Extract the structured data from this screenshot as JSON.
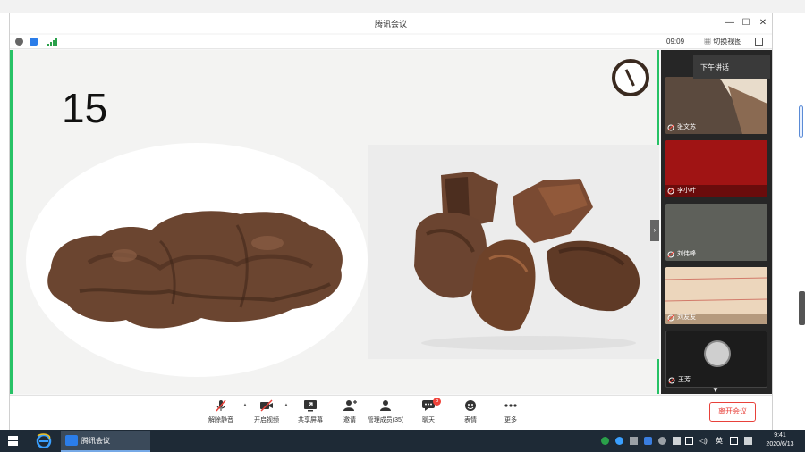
{
  "window": {
    "title": "腾讯会议",
    "min_glyph": "—",
    "max_glyph": "☐",
    "close_glyph": "✕"
  },
  "infobar": {
    "time": "09:09",
    "layout_label": "切换视图"
  },
  "slide": {
    "number": "15"
  },
  "participants": {
    "tooltip": "下午讲话",
    "tiles": [
      {
        "name": "张文苏",
        "bg": "#7a5f4a"
      },
      {
        "name": "李小叶",
        "bg": "#b01818"
      },
      {
        "name": "刘伟峰",
        "bg": "#5e605a"
      },
      {
        "name": "刘友友",
        "bg": "#e8d2b8"
      },
      {
        "name": "王芳",
        "bg": "#1c1c1c"
      }
    ]
  },
  "toolbar": {
    "items": [
      {
        "label": "解除静音",
        "icon": "mic-muted-icon"
      },
      {
        "label": "开启视频",
        "icon": "video-off-icon"
      },
      {
        "label": "共享屏幕",
        "icon": "share-screen-icon"
      },
      {
        "label": "邀请",
        "icon": "invite-icon"
      },
      {
        "label": "管理成员(35)",
        "icon": "members-icon"
      },
      {
        "label": "聊天",
        "icon": "chat-icon",
        "badge": "5"
      },
      {
        "label": "表情",
        "icon": "emoji-icon"
      },
      {
        "label": "更多",
        "icon": "more-icon"
      }
    ],
    "leave_label": "离开会议"
  },
  "taskbar": {
    "app_label": "腾讯会议",
    "time": "9:41",
    "date": "2020/6/13",
    "tray_text": "英"
  },
  "colors": {
    "accent_green": "#27c266",
    "leave_red": "#e8413a",
    "taskbar": "#1e2a36"
  }
}
